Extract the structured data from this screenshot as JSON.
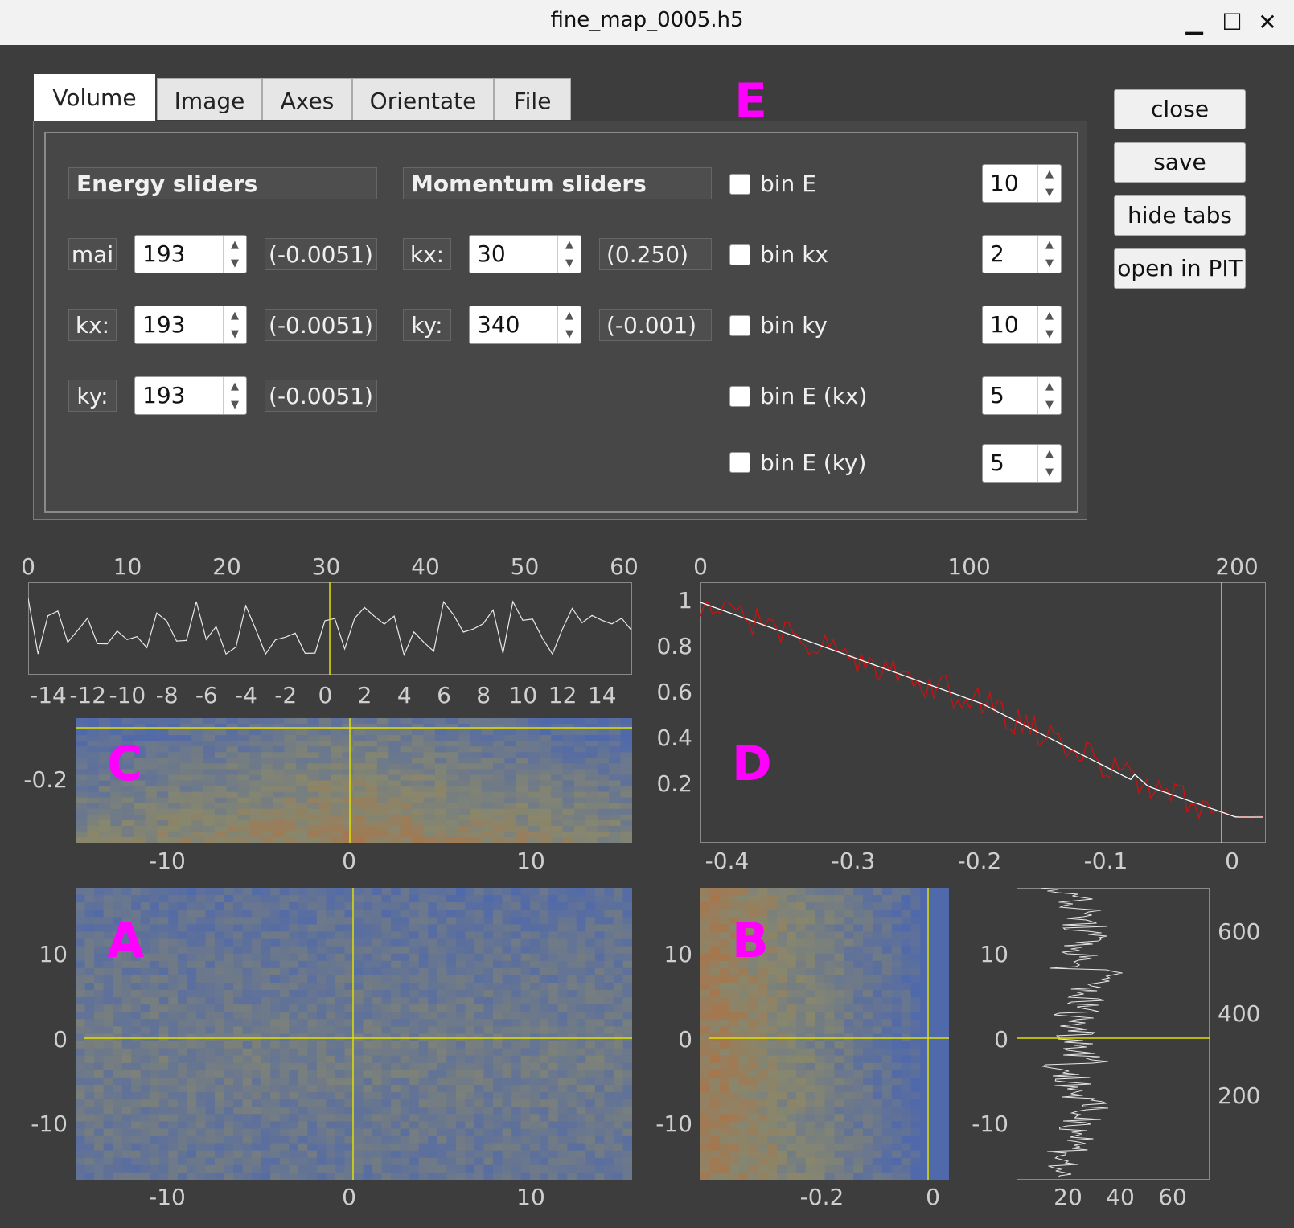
{
  "window": {
    "title": "fine_map_0005.h5"
  },
  "window_controls": {
    "minimize": "▁",
    "maximize": "☐",
    "close": "✕"
  },
  "tabs": [
    {
      "label": "Volume",
      "active": true
    },
    {
      "label": "Image"
    },
    {
      "label": "Axes"
    },
    {
      "label": "Orientate"
    },
    {
      "label": "File"
    }
  ],
  "energy_sliders": {
    "header": "Energy sliders",
    "rows": [
      {
        "label": "mai",
        "value": "193",
        "readout": "(-0.0051)"
      },
      {
        "label": "kx:",
        "value": "193",
        "readout": "(-0.0051)"
      },
      {
        "label": "ky:",
        "value": "193",
        "readout": "(-0.0051)"
      }
    ]
  },
  "momentum_sliders": {
    "header": "Momentum sliders",
    "rows": [
      {
        "label": "kx:",
        "value": "30",
        "readout": "(0.250)"
      },
      {
        "label": "ky:",
        "value": "340",
        "readout": "(-0.001)"
      }
    ]
  },
  "bins": [
    {
      "label": "bin E",
      "value": "10",
      "checked": false
    },
    {
      "label": "bin kx",
      "value": "2",
      "checked": false
    },
    {
      "label": "bin ky",
      "value": "10",
      "checked": false
    },
    {
      "label": "bin E (kx)",
      "value": "5",
      "checked": false
    },
    {
      "label": "bin E (ky)",
      "value": "5",
      "checked": false
    }
  ],
  "buttons": {
    "close": "close",
    "save": "save",
    "hide_tabs": "hide tabs",
    "open_in_pit": "open in PIT"
  },
  "panel_letters": {
    "A": "A",
    "B": "B",
    "C": "C",
    "D": "D",
    "E": "E"
  },
  "colors": {
    "cursor": "#e0e000",
    "edc": "#cc1111",
    "fit": "#ffffff",
    "accent": "#ff00ff"
  },
  "plots": {
    "top_left_line": {
      "top_axis": [
        "0",
        "10",
        "20",
        "30",
        "40",
        "50",
        "60"
      ],
      "bottom_axis": [
        "-14",
        "-12",
        "-10",
        "-8",
        "-6",
        "-4",
        "-2",
        "0",
        "2",
        "4",
        "6",
        "8",
        "10",
        "12",
        "14"
      ]
    },
    "C": {
      "y_ticks": [
        "-0.2"
      ],
      "x_ticks": [
        "-10",
        "0",
        "10"
      ]
    },
    "D": {
      "top_axis": [
        "0",
        "100",
        "200"
      ],
      "y_ticks": [
        "1",
        "0.8",
        "0.6",
        "0.4",
        "0.2"
      ],
      "x_ticks": [
        "-0.4",
        "-0.3",
        "-0.2",
        "-0.1",
        "0"
      ]
    },
    "A": {
      "y_ticks": [
        "10",
        "0",
        "-10"
      ],
      "x_ticks": [
        "-10",
        "0",
        "10"
      ]
    },
    "B": {
      "y_ticks": [
        "10",
        "0",
        "-10"
      ],
      "x_ticks": [
        "-0.2",
        "0"
      ]
    },
    "profile": {
      "y_ticks": [
        "10",
        "0",
        "-10"
      ],
      "right_ticks": [
        "600",
        "400",
        "200"
      ],
      "x_ticks": [
        "20",
        "40",
        "60"
      ]
    }
  }
}
